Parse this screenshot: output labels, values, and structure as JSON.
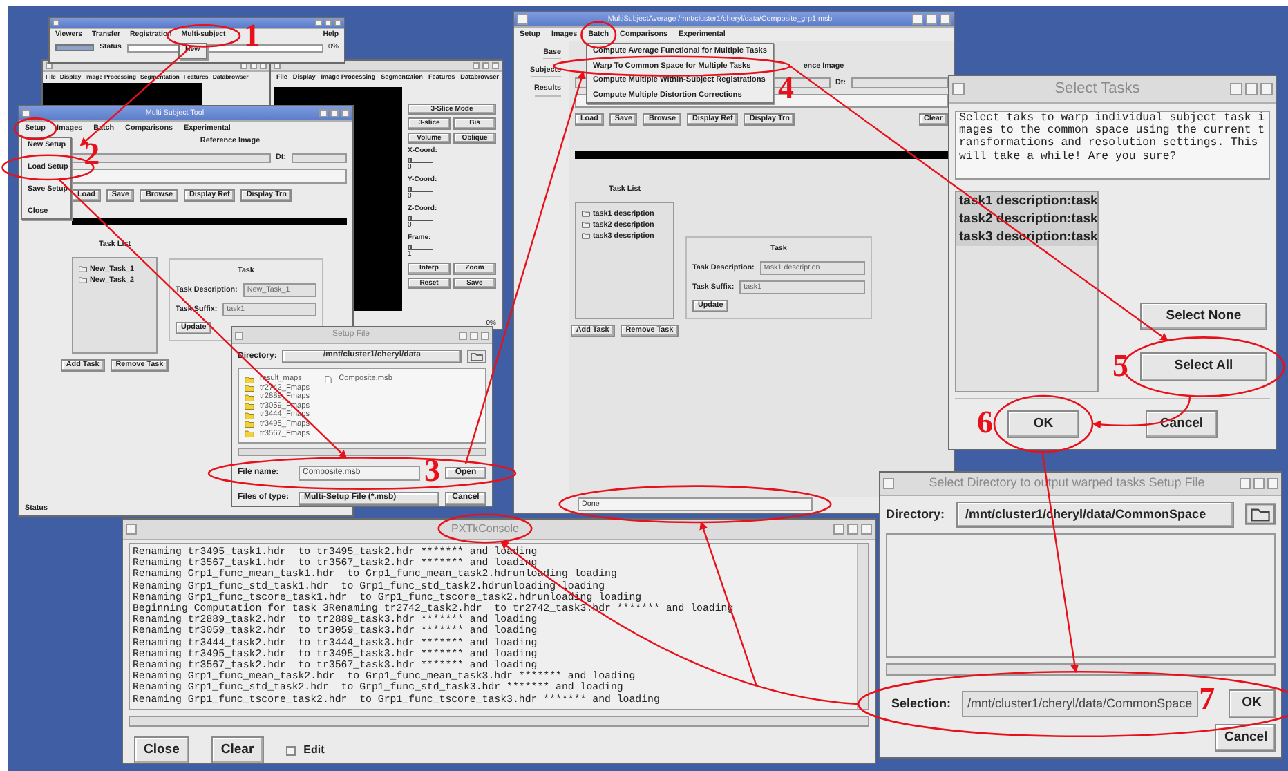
{
  "main_window": {
    "level": 1,
    "menu": [
      "Viewers",
      "Transfer",
      "Registration",
      "Multi-subject",
      "Help"
    ],
    "dropdown": [
      "New"
    ],
    "status_label": "Status",
    "progress": "0%"
  },
  "viewer_windows": [
    {
      "menu": [
        "File",
        "Display",
        "Image Processing",
        "Segmentation",
        "Features",
        "Databrowser"
      ]
    },
    {
      "menu": [
        "File",
        "Display",
        "Image Processing",
        "Segmentation",
        "Features",
        "Databrowser"
      ],
      "controls": [
        {
          "kind": "button",
          "label": "3-Slice Mode"
        },
        {
          "kind": "button",
          "label": "3-slice"
        },
        {
          "kind": "button",
          "label": "Bis"
        },
        {
          "kind": "button",
          "label": "Volume"
        },
        {
          "kind": "button",
          "label": "Oblique"
        },
        {
          "kind": "slider",
          "label": "X-Coord:",
          "value": "0",
          "level": 0
        },
        {
          "kind": "slider",
          "label": "Y-Coord:",
          "value": "0",
          "level": 0
        },
        {
          "kind": "slider",
          "label": "Z-Coord:",
          "value": "0",
          "level": 0
        },
        {
          "kind": "slider",
          "label": "Frame:",
          "value": "1",
          "level": 0
        },
        {
          "kind": "button",
          "label": "Interp"
        },
        {
          "kind": "button",
          "label": "Zoom"
        },
        {
          "kind": "button",
          "label": "Reset"
        },
        {
          "kind": "button",
          "label": "Save"
        }
      ],
      "progress": "0%"
    }
  ],
  "multi_subject_tool": {
    "title": "Multi Subject Tool",
    "menu": [
      "Setup",
      "Images",
      "Batch",
      "Comparisons",
      "Experimental"
    ],
    "setup_menu": [
      "New Setup",
      "Load Setup",
      "Save Setup",
      "Close"
    ],
    "reference_title": "Reference Image",
    "dt_label": "Dt:",
    "buttons": [
      "Load",
      "Save",
      "Browse",
      "Display Ref",
      "Display Trn"
    ],
    "task_list_title": "Task List",
    "tasks": [
      "New_Task_1",
      "New_Task_2"
    ],
    "task_buttons": [
      "Add Task",
      "Remove Task"
    ],
    "task_panel": {
      "title": "Task",
      "description_label": "Task Description:",
      "description": "New_Task_1",
      "suffix_label": "Task Suffix:",
      "suffix": "task1",
      "update": "Update"
    },
    "status_label": "Status"
  },
  "setup_file_dialog": {
    "title": "Setup File",
    "directory_label": "Directory:",
    "directory": "/mnt/cluster1/cheryl/data",
    "entries": [
      {
        "kind": "folder",
        "name": "result_maps"
      },
      {
        "kind": "folder",
        "name": "tr2742_Fmaps"
      },
      {
        "kind": "folder",
        "name": "tr2889_Fmaps"
      },
      {
        "kind": "folder",
        "name": "tr3059_Fmaps"
      },
      {
        "kind": "folder",
        "name": "tr3444_Fmaps"
      },
      {
        "kind": "folder",
        "name": "tr3495_Fmaps"
      },
      {
        "kind": "folder",
        "name": "tr3567_Fmaps"
      },
      {
        "kind": "file",
        "name": "Composite.msb"
      }
    ],
    "file_name_label": "File name:",
    "file_name": "Composite.msb",
    "open": "Open",
    "files_of_type_label": "Files of type:",
    "files_of_type": "Multi-Setup File (*.msb)",
    "cancel": "Cancel"
  },
  "average_window": {
    "title": "MultiSubjectAverage /mnt/cluster1/cheryl/data/Composite_grp1.msb",
    "menu": [
      "Setup",
      "Images",
      "Batch",
      "Comparisons",
      "Experimental"
    ],
    "tabs": [
      "Base",
      "Subjects",
      "Results"
    ],
    "batch_menu": [
      "Compute Average Functional for Multiple Tasks",
      "Warp To Common Space for Multiple Tasks",
      "Compute Multiple Within-Subject Registrations",
      "Compute Multiple Distortion Corrections"
    ],
    "reference_title": "ence Image",
    "dt_label": "Dt:",
    "buttons": [
      "Load",
      "Save",
      "Browse",
      "Display Ref",
      "Display Trn"
    ],
    "clear": "Clear",
    "task_list_title": "Task List",
    "tasks": [
      "task1 description",
      "task2 description",
      "task3 description"
    ],
    "task_buttons": [
      "Add Task",
      "Remove Task"
    ],
    "task_panel": {
      "title": "Task",
      "description_label": "Task Description:",
      "description": "task1 description",
      "suffix_label": "Task Suffix:",
      "suffix": "task1",
      "update": "Update"
    },
    "status": "Done"
  },
  "select_tasks_dialog": {
    "title": "Select Tasks",
    "message": "Select taks to warp individual subject task images to the common space using the current transformations and resolution settings. This will take a while! Are you sure?",
    "items": [
      {
        "label": "task1 description:task",
        "selected": true
      },
      {
        "label": "task2 description:task",
        "selected": true
      },
      {
        "label": "task3 description:task",
        "selected": true
      }
    ],
    "select_none": "Select None",
    "select_all": "Select All",
    "ok": "OK",
    "cancel": "Cancel"
  },
  "console": {
    "title": "PXTkConsole",
    "lines": [
      "Renaming tr3495_task1.hdr  to tr3495_task2.hdr ******* and loading",
      "Renaming tr3567_task1.hdr  to tr3567_task2.hdr ******* and loading",
      "Renaming Grp1_func_mean_task1.hdr  to Grp1_func_mean_task2.hdrunloading loading",
      "Renaming Grp1_func_std_task1.hdr  to Grp1_func_std_task2.hdrunloading loading",
      "Renaming Grp1_func_tscore_task1.hdr  to Grp1_func_tscore_task2.hdrunloading loading",
      "Beginning Computation for task 3Renaming tr2742_task2.hdr  to tr2742_task3.hdr ******* and loading",
      "Renaming tr2889_task2.hdr  to tr2889_task3.hdr ******* and loading",
      "Renaming tr3059_task2.hdr  to tr3059_task3.hdr ******* and loading",
      "Renaming tr3444_task2.hdr  to tr3444_task3.hdr ******* and loading",
      "Renaming tr3495_task2.hdr  to tr3495_task3.hdr ******* and loading",
      "Renaming tr3567_task2.hdr  to tr3567_task3.hdr ******* and loading",
      "Renaming Grp1_func_mean_task2.hdr  to Grp1_func_mean_task3.hdr ******* and loading",
      "Renaming Grp1_func_std_task2.hdr  to Grp1_func_std_task3.hdr ******* and loading",
      "Renaming Grp1_func_tscore_task2.hdr  to Grp1_func_tscore_task3.hdr ******* and loading"
    ],
    "buttons": [
      "Close",
      "Clear"
    ],
    "edit": {
      "label": "Edit",
      "checked": false
    }
  },
  "select_directory_dialog": {
    "title": "Select Directory to output warped tasks Setup File",
    "directory_label": "Directory:",
    "directory": "/mnt/cluster1/cheryl/data/CommonSpace",
    "selection_label": "Selection:",
    "selection": "/mnt/cluster1/cheryl/data/CommonSpace",
    "ok": "OK",
    "cancel": "Cancel"
  },
  "step_numbers": [
    "1",
    "2",
    "3",
    "4",
    "5",
    "6",
    "7"
  ]
}
